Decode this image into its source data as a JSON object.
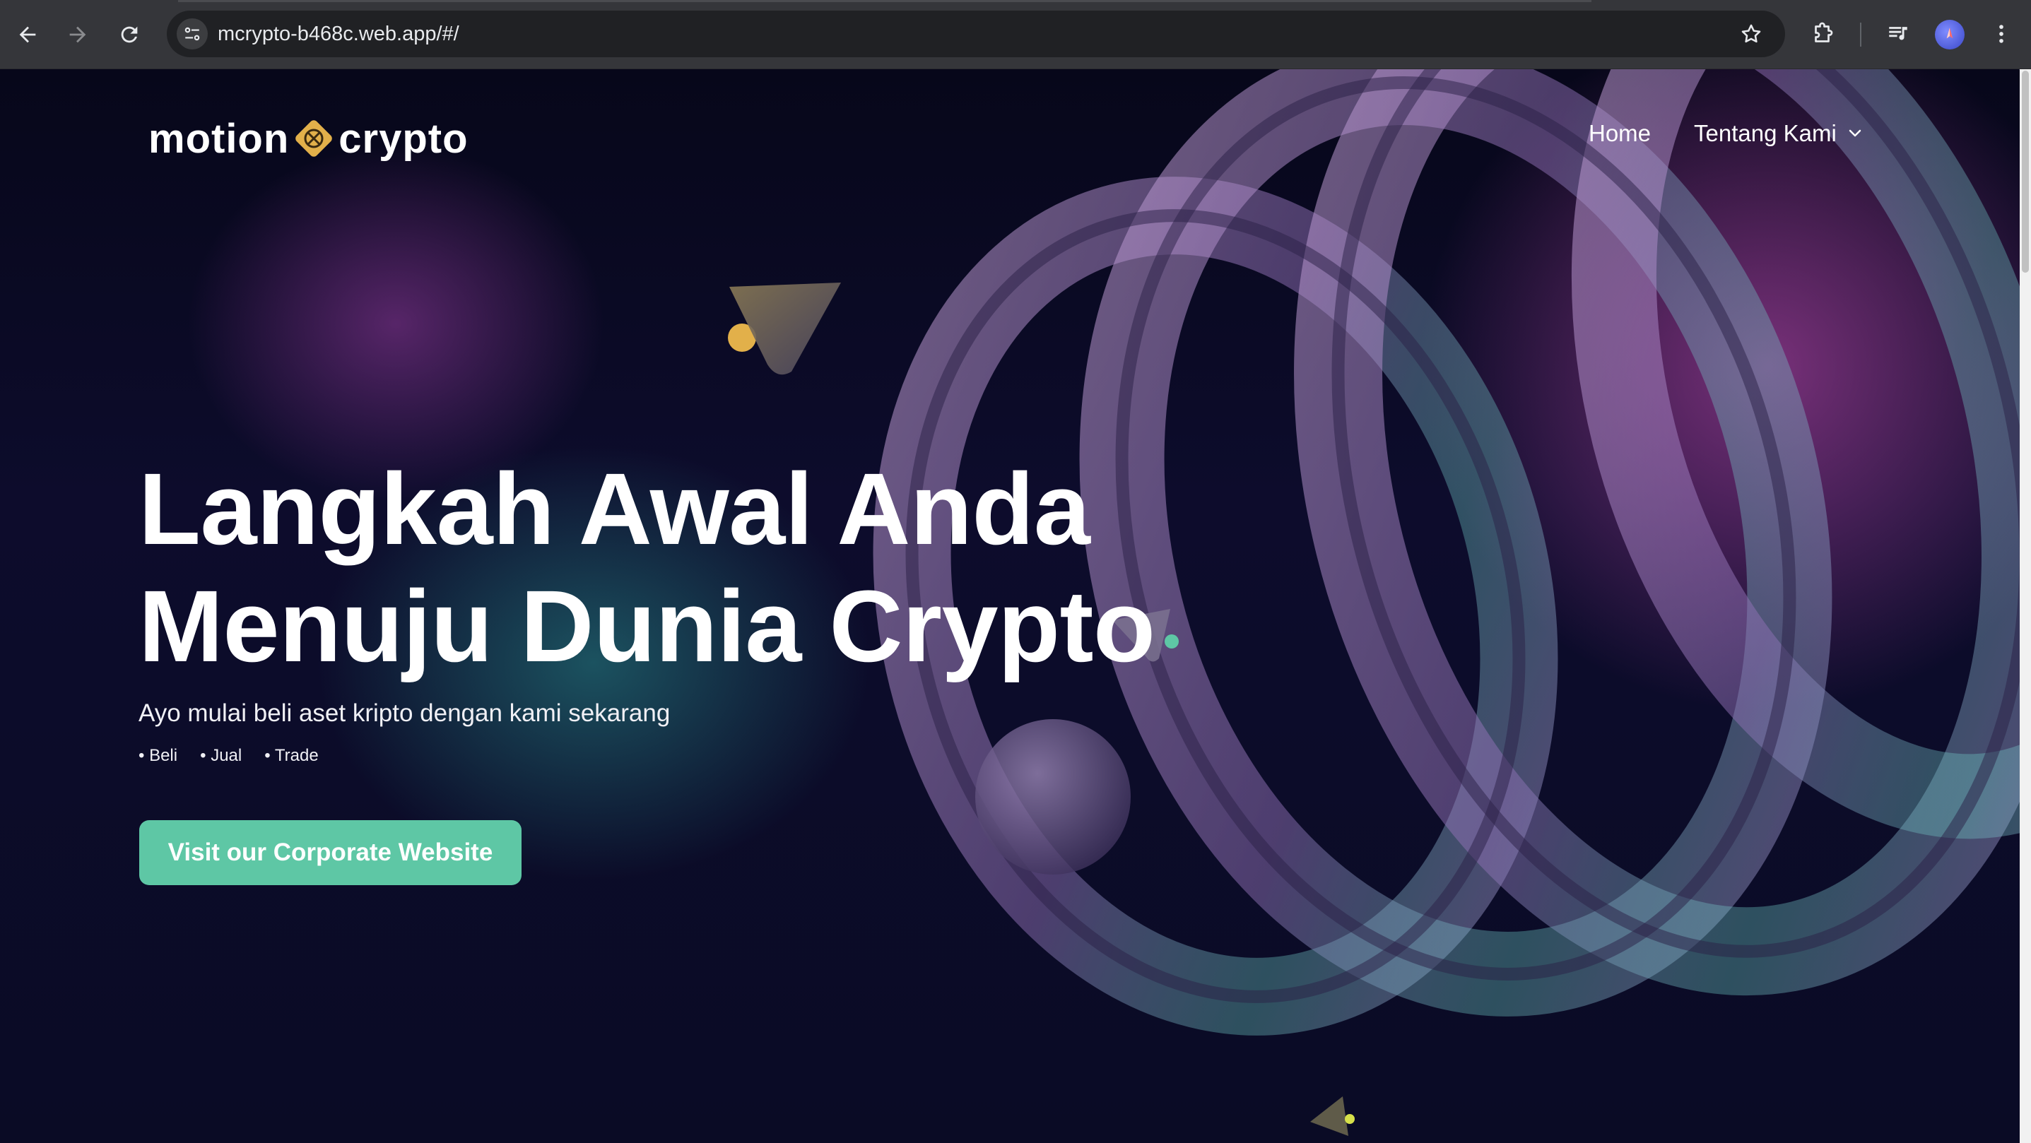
{
  "browser": {
    "url": "mcrypto-b468c.web.app/#/"
  },
  "header": {
    "logo_left": "motion",
    "logo_right": "crypto",
    "nav": {
      "home": "Home",
      "about": "Tentang Kami"
    }
  },
  "hero": {
    "title_line1": "Langkah Awal Anda",
    "title_line2": "Menuju Dunia Crypto",
    "subtitle": "Ayo mulai beli aset kripto dengan kami sekarang",
    "bullets": [
      "Beli",
      "Jual",
      "Trade"
    ],
    "cta_label": "Visit our Corporate Website"
  },
  "colors": {
    "cta": "#5ec7a5",
    "logo_gold": "#e2b04a",
    "background": "#0b0b22",
    "accent_pink": "#d250be",
    "accent_teal": "#288c8c"
  },
  "icons": [
    "back-icon",
    "forward-icon",
    "reload-icon",
    "site-info-icon",
    "star-icon",
    "extensions-icon",
    "media-icon",
    "profile-avatar",
    "menu-dots-icon",
    "chevron-down-icon"
  ]
}
